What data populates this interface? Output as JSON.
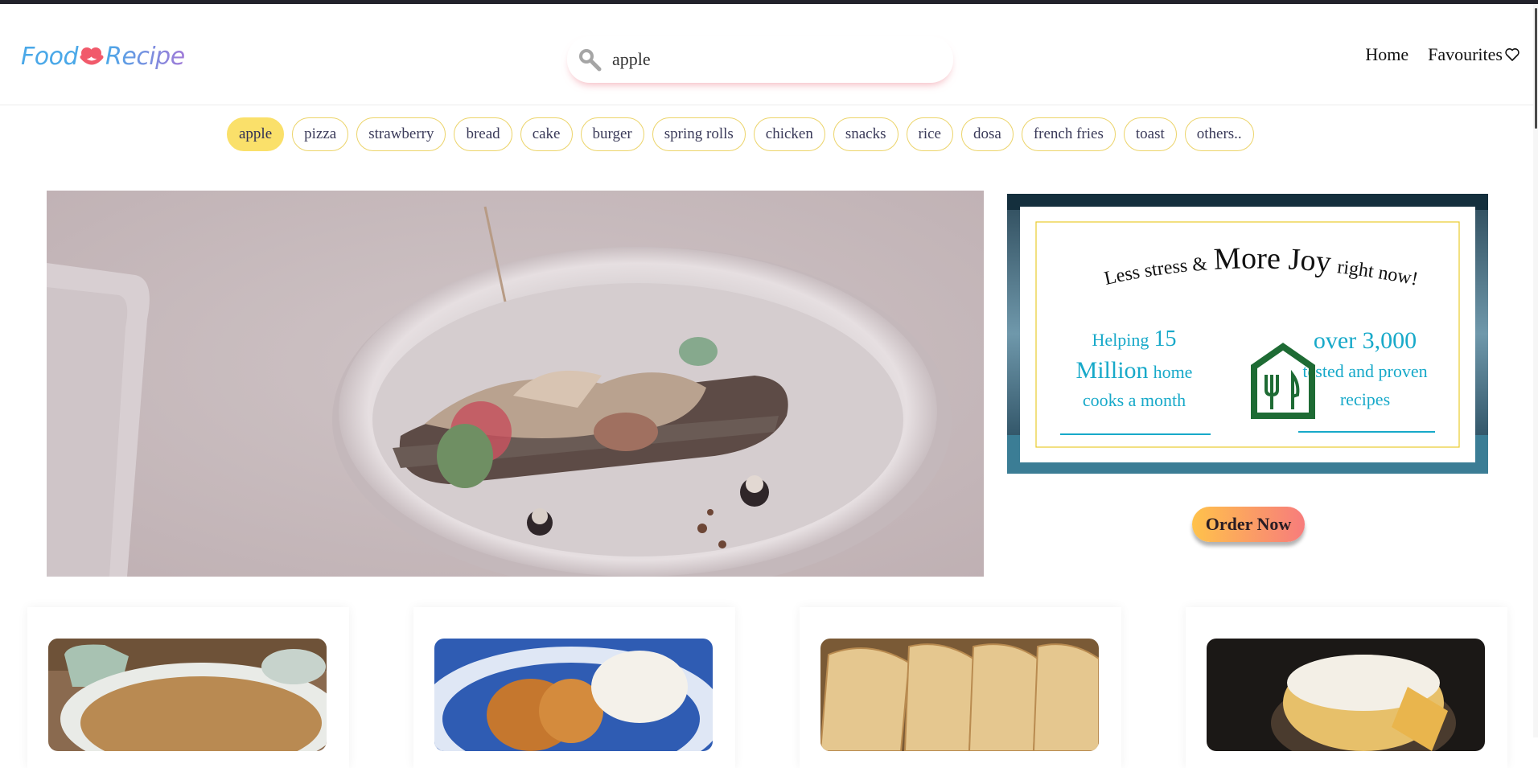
{
  "app": {
    "logo_left": "Food",
    "logo_right": "Recipe"
  },
  "search": {
    "value": "apple",
    "placeholder": ""
  },
  "nav": {
    "home": "Home",
    "favourites": "Favourites"
  },
  "chips": [
    {
      "label": "apple",
      "active": true
    },
    {
      "label": "pizza"
    },
    {
      "label": "strawberry"
    },
    {
      "label": "bread"
    },
    {
      "label": "cake"
    },
    {
      "label": "burger"
    },
    {
      "label": "spring rolls"
    },
    {
      "label": "chicken"
    },
    {
      "label": "snacks"
    },
    {
      "label": "rice"
    },
    {
      "label": "dosa"
    },
    {
      "label": "french fries"
    },
    {
      "label": "toast"
    },
    {
      "label": "others.."
    }
  ],
  "promo": {
    "tagline_a": "Less stress &",
    "tagline_b": "More Joy",
    "tagline_c": "right now!",
    "stat_left_a": "Helping",
    "stat_left_num": "15",
    "stat_left_million": "Million",
    "stat_left_b": "home",
    "stat_left_c": "cooks a month",
    "stat_right_a": "over 3,000",
    "stat_right_b": "tested and proven",
    "stat_right_c": "recipes"
  },
  "order_button": "Order Now",
  "colors": {
    "accent_yellow": "#fae06a",
    "cyan_text": "#17a9c9",
    "green_icon": "#1e6b34",
    "order_gradient_start": "#ffc24b",
    "order_gradient_end": "#f77c7c"
  }
}
